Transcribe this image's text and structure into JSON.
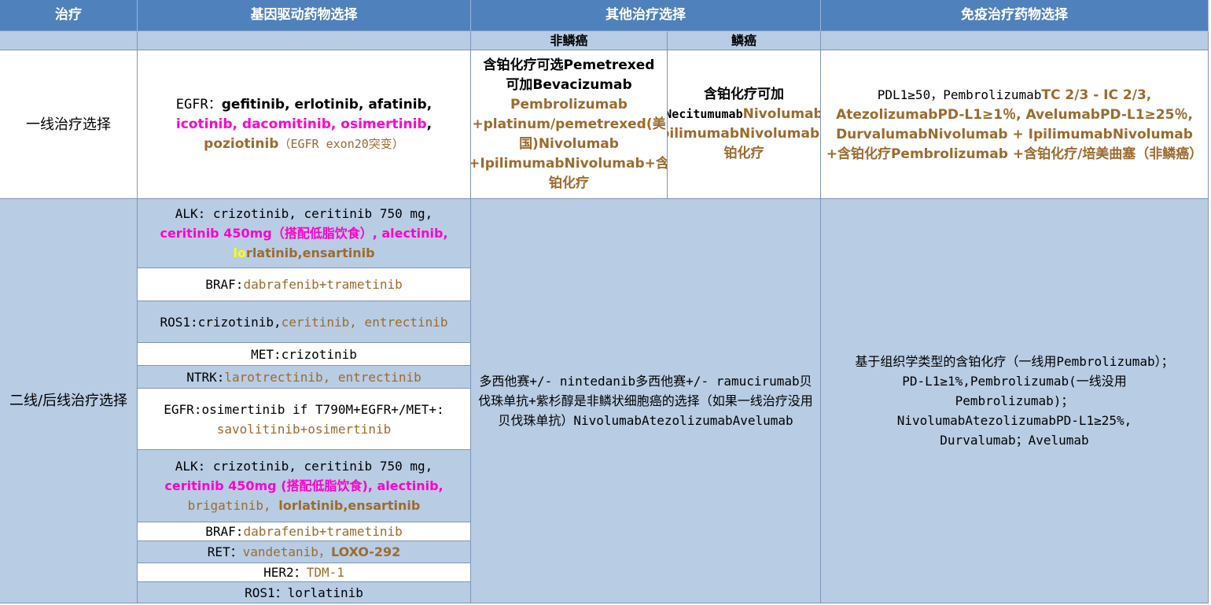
{
  "header": {
    "col1": "治疗",
    "col2": "基因驱动药物选择",
    "col3": "其他治疗选择",
    "col4": "免疫治疗药物选择"
  },
  "subheader": {
    "non_squamous": "非鳞癌",
    "squamous": "鳞癌"
  },
  "first_line": {
    "label": "一线治疗选择",
    "gene": {
      "p1": "EGFR：",
      "p2": "gefitinib, erlotinib, afatinib,",
      "p3": "icotinib, dacomitinib, osimertinib",
      "p4": ",",
      "p5": "poziotinib",
      "p6": "（EGFR exon20突变）"
    },
    "nonsq": {
      "p1": "含铂化疗可选Pemetrexed",
      "p2": "可加Bevacizumab",
      "p3": "Pembrolizumab +platinum/pemetrexed(美国)Nivolumab +IpilimumabNivolumab+含铂化疗"
    },
    "sq": {
      "p1": "含铂化疗可加",
      "p2": "Necitumumab",
      "p3": "Nivolumab +IpilimumabNivolumab+含铂化疗"
    },
    "immuno": {
      "p1": "PDL1≥50，Pembrolizumab",
      "p2": "TC 2/3 - IC 2/3, AtezolizumabPD-L1≥1％, AvelumabPD-L1≥25％, DurvalumabNivolumab + IpilimumabNivolumab +含铂化疗Pembrolizumab +含铂化疗/培美曲塞（非鳞癌）"
    }
  },
  "second_line": {
    "label": "二线/后线治疗选择",
    "rows": [
      {
        "a": "ALK: crizotinib, ceritinib 750 mg,",
        "b": "ceritinib 450mg（搭配低脂饮食）, alectinib,",
        "c1": "lo",
        "c2": "rlatinib,ensartinib"
      },
      {
        "a": "BRAF:",
        "b": "dabrafenib+trametinib"
      },
      {
        "a": "ROS1:crizotinib,",
        "b": "ceritinib, entrectinib"
      },
      {
        "a": "MET:crizotinib"
      },
      {
        "a": "NTRK:",
        "b": "larotrectinib, entrectinib"
      },
      {
        "a": "EGFR:osimertinib if T790M+EGFR+/MET+:",
        "b": "savolitinib+osimertinib"
      },
      {
        "a": "ALK: crizotinib, ceritinib 750 mg,",
        "b": "ceritinib 450mg (搭配低脂饮食), alectinib,",
        "c1": "brigatinib, ",
        "c2": "lorlatinib,ensartinib"
      },
      {
        "a": "BRAF:",
        "b": "dabrafenib+trametinib"
      },
      {
        "a": "RET：",
        "b": "vandetanib，",
        "c": "LOXO-292"
      },
      {
        "a": "HER2：",
        "b": "TDM-1"
      },
      {
        "a": "ROS1：lorlatinib"
      }
    ],
    "other": "多西他赛+/- nintedanib多西他赛+/- ramucirumab贝伐珠单抗+紫杉醇是非鳞状细胞癌的选择（如果一线治疗没用贝伐珠单抗）NivolumabAtezolizumabAvelumab",
    "immuno": {
      "l1": "基于组织学类型的含铂化疗（一线用Pembrolizumab）；",
      "l2": "PD-L1≥1%,Pembrolizumab(一线没用Pembrolizumab)；",
      "l3": "NivolumabAtezolizumabPD-L1≥25%,",
      "l4": "Durvalumab；Avelumab"
    }
  },
  "colors": {
    "header_bg": "#4f81bd",
    "light_bg": "#b8cce4",
    "pink": "#ff00cc",
    "brown": "#9c6b2e"
  }
}
